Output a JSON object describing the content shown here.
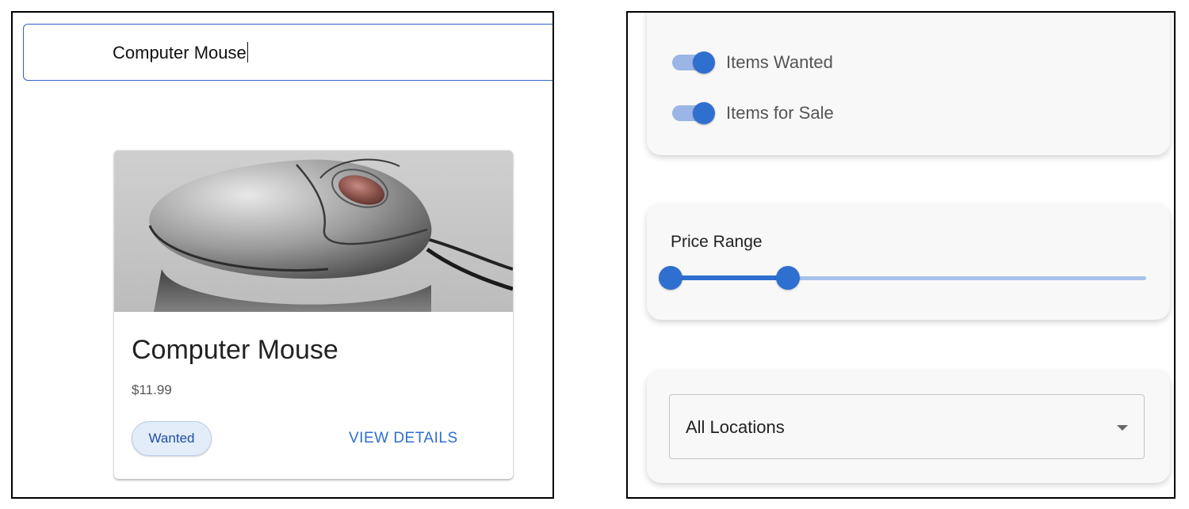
{
  "search": {
    "value": "Computer Mouse"
  },
  "product": {
    "title": "Computer Mouse",
    "price": "$11.99",
    "badge": "Wanted",
    "action": "VIEW DETAILS",
    "image_icon": "computer-mouse-photo"
  },
  "filters": {
    "toggles": [
      {
        "label": "Items Wanted",
        "on": true
      },
      {
        "label": "Items for Sale",
        "on": true
      }
    ],
    "price_range": {
      "label": "Price Range",
      "min_fraction": 0.0,
      "max_fraction": 0.25
    },
    "location": {
      "selected": "All Locations"
    }
  },
  "colors": {
    "accent": "#2f6fd0",
    "chip_bg": "#e3edf9"
  }
}
